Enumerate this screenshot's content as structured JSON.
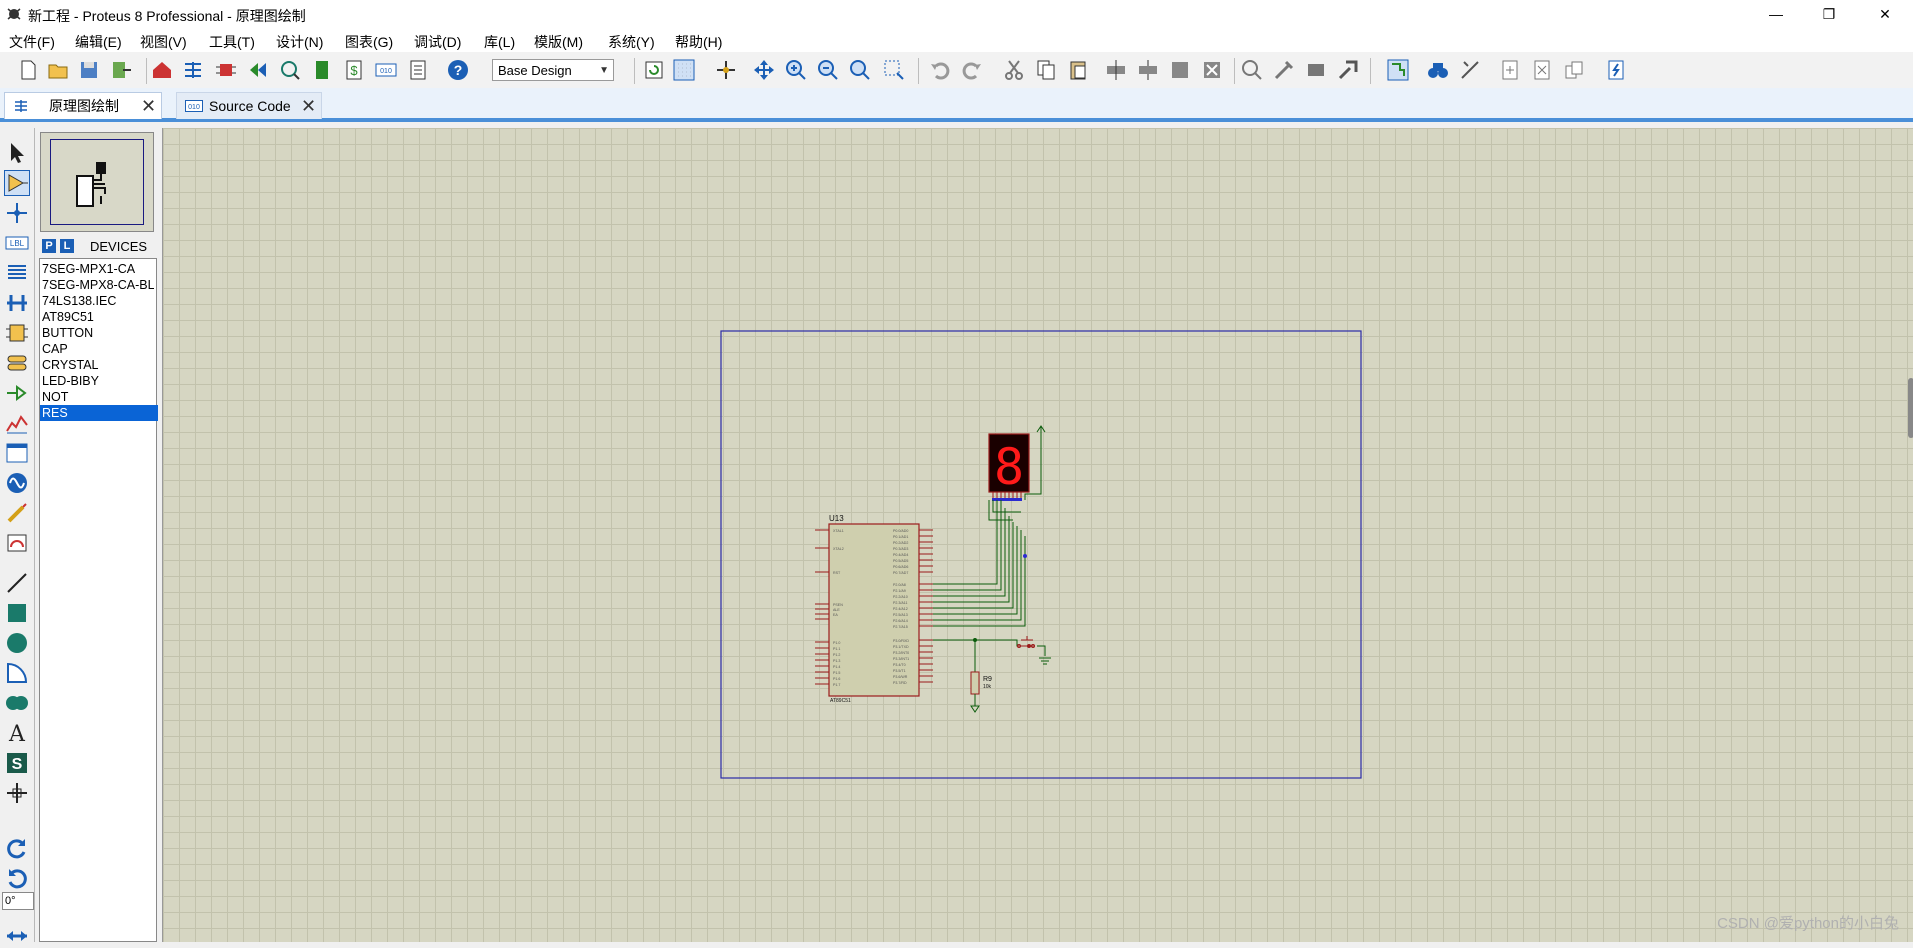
{
  "window": {
    "title": "新工程 - Proteus 8 Professional - 原理图绘制",
    "minimize": "—",
    "restore": "❐",
    "close": "✕"
  },
  "menu": [
    "文件(F)",
    "编辑(E)",
    "视图(V)",
    "工具(T)",
    "设计(N)",
    "图表(G)",
    "调试(D)",
    "库(L)",
    "模版(M)",
    "系统(Y)",
    "帮助(H)"
  ],
  "toolbar": {
    "design_select": "Base Design"
  },
  "tabs": [
    {
      "label": "原理图绘制",
      "close": "✕",
      "active": true
    },
    {
      "label": "Source Code",
      "close": "✕",
      "active": false
    }
  ],
  "device_panel": {
    "p_label": "P",
    "l_label": "L",
    "header": "DEVICES",
    "items": [
      "7SEG-MPX1-CA",
      "7SEG-MPX8-CA-BL",
      "74LS138.IEC",
      "AT89C51",
      "BUTTON",
      "CAP",
      "CRYSTAL",
      "LED-BIBY",
      "NOT",
      "RES"
    ],
    "selected": "RES"
  },
  "rotation": "0°",
  "schematic": {
    "mcu_ref": "U13",
    "mcu_part": "AT89C51",
    "resistor_ref": "R9",
    "resistor_value": "10k",
    "display_digit": "8"
  },
  "watermark": "CSDN @爱python的小白兔",
  "colors": {
    "canvas": "#d6d6c2",
    "sheet_border": "#2b2ba8",
    "component": "#9b1b1b",
    "wire": "#0b5c0b",
    "seg_on": "#ff1a1a",
    "accent": "#0a64d6"
  }
}
